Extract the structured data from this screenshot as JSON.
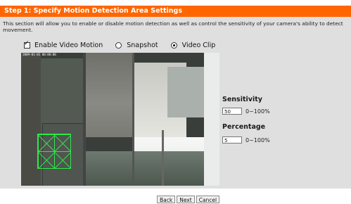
{
  "header": {
    "title": "Step 1: Specify Motion Detection Area Settings"
  },
  "description": "This section will allow you to enable or disable motion detection as well as control the sensitivity of your camera's ability to detect movement.",
  "options": {
    "enable_label": "Enable Video Motion",
    "enable_checked": true,
    "snapshot_label": "Snapshot",
    "videoclip_label": "Video Clip",
    "selected": "Video Clip"
  },
  "video": {
    "osd_text": "2009-01-01 00:00:00"
  },
  "sensitivity": {
    "label": "Sensitivity",
    "value": "50",
    "range": "0~100%"
  },
  "percentage": {
    "label": "Percentage",
    "value": "5",
    "range": "0~100%"
  },
  "buttons": {
    "back": "Back",
    "next": "Next",
    "cancel": "Cancel"
  },
  "colors": {
    "header": "#ff6600",
    "panel": "#dfdfdf",
    "motion_grid": "#2fe84a"
  }
}
